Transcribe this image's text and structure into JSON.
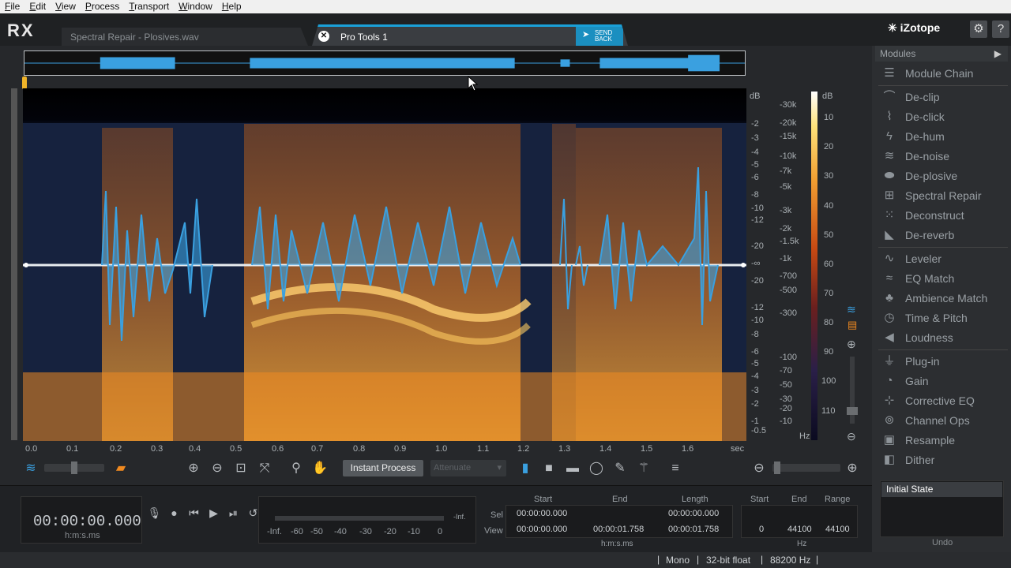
{
  "menu": [
    "File",
    "Edit",
    "View",
    "Process",
    "Transport",
    "Window",
    "Help"
  ],
  "app": {
    "logo": "RX",
    "brand": "iZotope"
  },
  "tabs": {
    "inactive": "Spectral Repair - Plosives.wav",
    "active": "Pro Tools 1",
    "send_back": "SEND BACK"
  },
  "top_icons": {
    "settings": "gear-icon",
    "help": "?"
  },
  "db_scale_left": {
    "unit": "dB",
    "labels": [
      "-2",
      "-3",
      "-4",
      "-5",
      "-6",
      "-8",
      "-10",
      "-12",
      "-20",
      "-∞",
      "-20",
      "-12",
      "-10",
      "-8",
      "-6",
      "-5",
      "-4",
      "-3",
      "-2",
      "-1",
      "-0.5"
    ]
  },
  "freq_scale": {
    "unit": "Hz",
    "labels": [
      "-30k",
      "-20k",
      "-15k",
      "-10k",
      "-7k",
      "-5k",
      "-3k",
      "-2k",
      "-1.5k",
      "-1k",
      "-700",
      "-500",
      "-300",
      "-100",
      "-70",
      "-50",
      "-30",
      "-20",
      "-10"
    ]
  },
  "colorbar_scale": {
    "unit": "dB",
    "labels": [
      "10",
      "20",
      "30",
      "40",
      "50",
      "60",
      "70",
      "80",
      "90",
      "100",
      "110"
    ]
  },
  "time_axis": {
    "labels": [
      "0.0",
      "0.1",
      "0.2",
      "0.3",
      "0.4",
      "0.5",
      "0.6",
      "0.7",
      "0.8",
      "0.9",
      "1.0",
      "1.1",
      "1.2",
      "1.3",
      "1.4",
      "1.5",
      "1.6"
    ],
    "unit": "sec"
  },
  "toolbar": {
    "instant_process": "Instant Process",
    "attenuate": "Attenuate"
  },
  "modules": {
    "header": "Modules",
    "chain": "Module Chain",
    "group1": [
      "De-clip",
      "De-click",
      "De-hum",
      "De-noise",
      "De-plosive",
      "Spectral Repair",
      "Deconstruct",
      "De-reverb"
    ],
    "group2": [
      "Leveler",
      "EQ Match",
      "Ambience Match",
      "Time & Pitch",
      "Loudness"
    ],
    "group3": [
      "Plug-in",
      "Gain",
      "Corrective EQ",
      "Channel Ops",
      "Resample",
      "Dither"
    ]
  },
  "transport": {
    "timecode": "00:00:00.000",
    "format": "h:m:s.ms"
  },
  "meter": {
    "labels": [
      "-Inf.",
      "-60",
      "-50",
      "-40",
      "-30",
      "-20",
      "-10",
      "0"
    ],
    "inf": "-Inf."
  },
  "selection": {
    "headers": [
      "Start",
      "End",
      "Length"
    ],
    "row_labels": [
      "Sel",
      "View"
    ],
    "sel": [
      "00:00:00.000",
      "",
      "00:00:00.000"
    ],
    "view": [
      "00:00:00.000",
      "00:00:01.758",
      "00:00:01.758"
    ],
    "format": "h:m:s.ms"
  },
  "freq_range": {
    "headers": [
      "Start",
      "End",
      "Range"
    ],
    "values": [
      "0",
      "44100",
      "44100"
    ],
    "unit": "Hz"
  },
  "history": {
    "state": "Initial State",
    "label": "Undo"
  },
  "status": {
    "channels": "Mono",
    "bitdepth": "32-bit float",
    "rate": "88200 Hz"
  }
}
